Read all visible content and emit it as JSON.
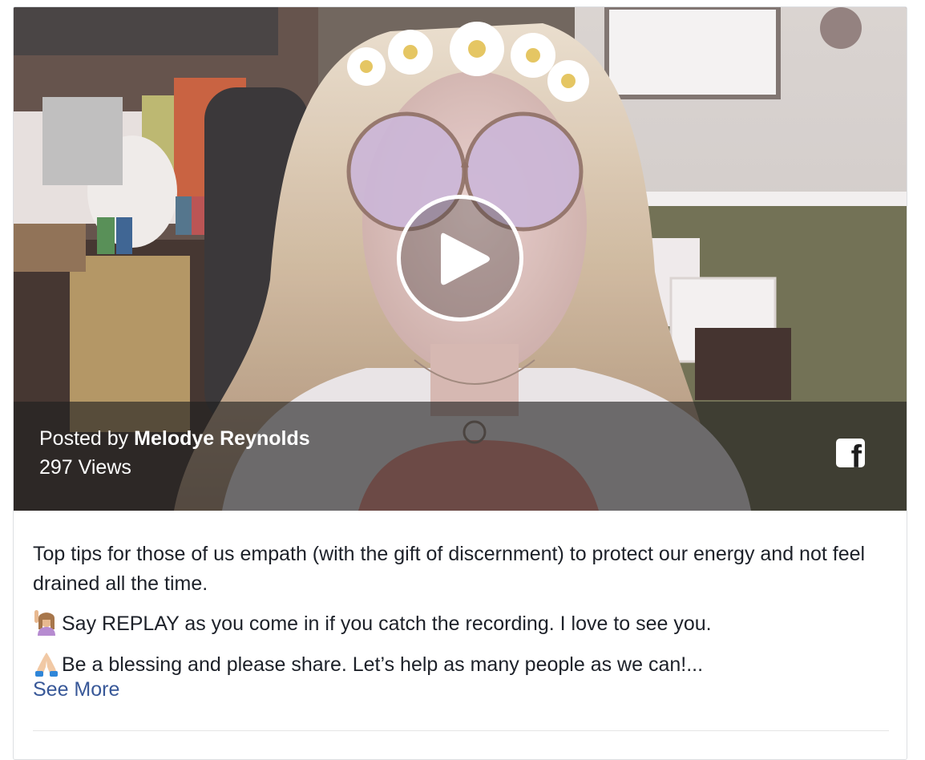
{
  "video": {
    "posted_prefix": "Posted by",
    "author": "Melodye Reynolds",
    "views": "297 Views",
    "play_icon": "play-icon",
    "share_icon": "facebook-icon"
  },
  "post": {
    "lines": [
      "Top tips for those of us empath (with the gift of discernment) to protect our energy and not feel drained all the time.",
      "Say REPLAY as you come in if you catch the recording. I love to see you.",
      "Be a blessing and please share. Let’s help as many people as we can!..."
    ],
    "line_icons": [
      "raising-hand-emoji",
      "folded-hands-emoji"
    ],
    "see_more": "See More"
  },
  "colors": {
    "link": "#385898",
    "text": "#1d2129",
    "overlay": "rgba(30,30,30,0.62)"
  }
}
